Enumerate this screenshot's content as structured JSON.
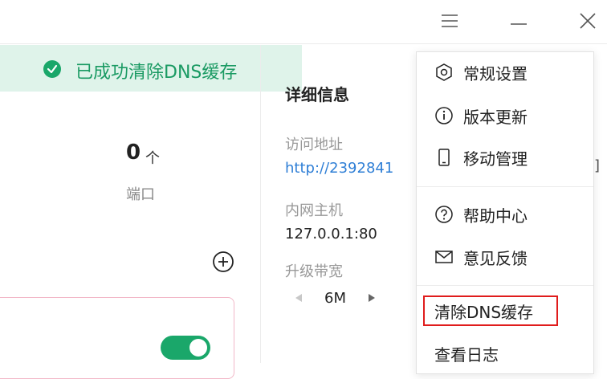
{
  "titlebar": {
    "menu_icon": "hamburger-icon",
    "minimize_icon": "minimize-icon",
    "close_icon": "close-icon"
  },
  "toast": {
    "icon": "check-circle-icon",
    "message": "已成功清除DNS缓存",
    "color": "#1aa76a"
  },
  "stats": {
    "port_count": "0",
    "port_unit": "个",
    "port_label": "端口"
  },
  "detail": {
    "title": "详细信息",
    "access_label": "访问地址",
    "access_value": "http://2392841",
    "host_label": "内网主机",
    "host_value": "127.0.0.1:80",
    "bandwidth_label": "升级带宽",
    "bandwidth_value": "6M"
  },
  "menu": {
    "items": [
      {
        "icon": "settings-icon",
        "label": "常规设置"
      },
      {
        "icon": "info-icon",
        "label": "版本更新"
      },
      {
        "icon": "mobile-icon",
        "label": "移动管理"
      },
      {
        "icon": "help-icon",
        "label": "帮助中心"
      },
      {
        "icon": "mail-icon",
        "label": "意见反馈"
      },
      {
        "icon": "",
        "label": "清除DNS缓存"
      },
      {
        "icon": "",
        "label": "查看日志"
      }
    ]
  },
  "colors": {
    "accent": "#1aa76a",
    "link": "#2f7fd6",
    "highlight": "#e01c1c"
  }
}
